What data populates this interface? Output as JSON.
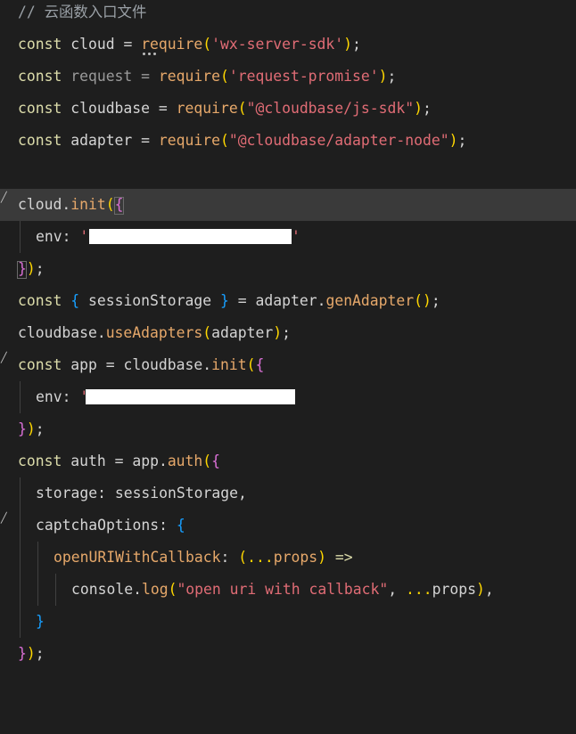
{
  "editor": {
    "theme_colors": {
      "background": "#1e1e1e",
      "highlight": "#3a3a3a",
      "keyword": "#dcdcaa",
      "function": "#e6a86a",
      "string": "#e06c75",
      "bracket_1": "#ffd700",
      "bracket_2": "#da70d6",
      "bracket_3": "#179fff"
    },
    "comment": "// 云函数入口文件",
    "lines": {
      "l2": {
        "kw": "const",
        "name": "cloud",
        "eq": "=",
        "fn": "require",
        "str": "'wx-server-sdk'",
        "end": ";"
      },
      "l3": {
        "kw": "const",
        "name": "request",
        "eq": "=",
        "fn": "require",
        "str": "'request-promise'",
        "end": ";"
      },
      "l4": {
        "kw": "const",
        "name": "cloudbase",
        "eq": "=",
        "fn": "require",
        "str": "\"@cloudbase/js-sdk\"",
        "end": ";"
      },
      "l5": {
        "kw": "const",
        "name": "adapter",
        "eq": "=",
        "fn": "require",
        "str": "\"@cloudbase/adapter-node\"",
        "end": ";"
      },
      "l7": {
        "obj": "cloud",
        "dot": ".",
        "fn": "init"
      },
      "l8": {
        "key": "env:",
        "str_start": "'",
        "str_end": "'"
      },
      "l9": {
        "text": ";"
      },
      "l10": {
        "kw": "const",
        "lbrace": "{",
        "name": "sessionStorage",
        "rbrace": "}",
        "eq": "=",
        "obj": "adapter",
        "dot": ".",
        "fn": "genAdapter",
        "end": ";"
      },
      "l11": {
        "obj": "cloudbase",
        "dot": ".",
        "fn": "useAdapters",
        "arg": "adapter",
        "end": ";"
      },
      "l12": {
        "kw": "const",
        "name": "app",
        "eq": "=",
        "obj": "cloudbase",
        "dot": ".",
        "fn": "init"
      },
      "l13": {
        "key": "env:",
        "str_start": "'"
      },
      "l14": {
        "text": ";"
      },
      "l15": {
        "kw": "const",
        "name": "auth",
        "eq": "=",
        "obj": "app",
        "dot": ".",
        "fn": "auth"
      },
      "l16": {
        "key": "storage:",
        "val": "sessionStorage",
        "end": ","
      },
      "l17": {
        "key": "captchaOptions:",
        "brace": "{"
      },
      "l18": {
        "fn": "openURIWithCallback",
        "colon": ":",
        "spread": "...",
        "arg": "props",
        "arrow": "=>"
      },
      "l19": {
        "obj": "console",
        "dot": ".",
        "fn": "log",
        "str": "\"open uri with callback\"",
        "comma": ",",
        "spread": "...",
        "arg": "props",
        "end": ","
      },
      "l20": {
        "brace": "}"
      },
      "l21": {
        "text": ";"
      }
    }
  }
}
